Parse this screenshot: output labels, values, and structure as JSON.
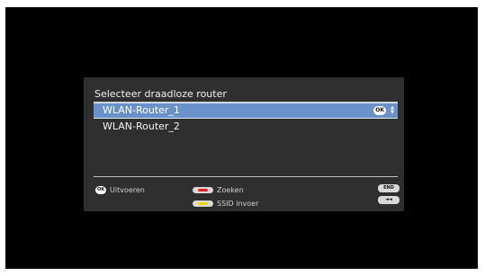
{
  "dialog": {
    "title": "Selecteer draadloze router"
  },
  "routers": [
    {
      "label": "WLAN-Router_1",
      "selected": true
    },
    {
      "label": "WLAN-Router_2",
      "selected": false
    }
  ],
  "row_hint": {
    "ok_label": "OK",
    "scroll_up": "▲",
    "scroll_down": "▼"
  },
  "footer": {
    "ok_badge": "OK",
    "execute_label": "Uitvoeren",
    "search_label": "Zoeken",
    "ssid_label": "SSID invoer",
    "end_key": "END",
    "back_key": "◄◄"
  },
  "colors": {
    "red_button": "#e0242b",
    "yellow_button": "#f1d400",
    "selection": "#6a91c9"
  }
}
